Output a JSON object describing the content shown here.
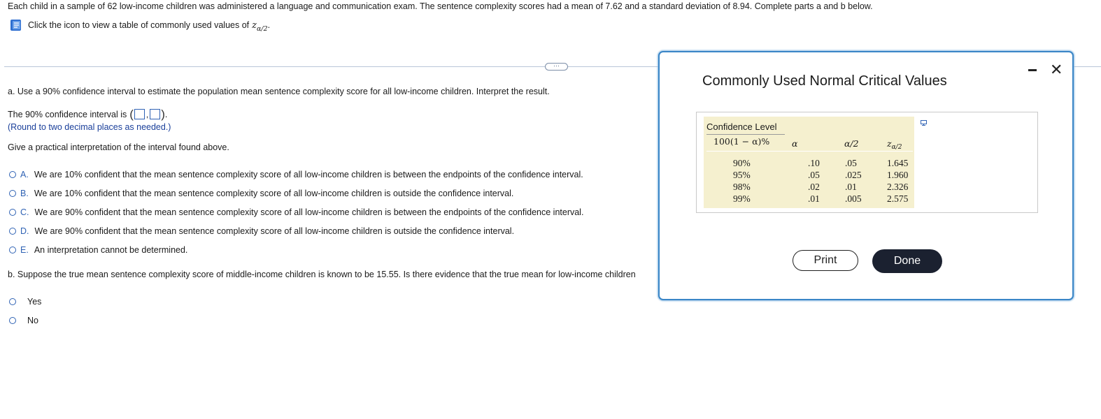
{
  "problem": {
    "intro": "Each child in a sample of 62 low-income children was administered a language and communication exam. The sentence complexity scores had a mean of 7.62 and a standard deviation of 8.94. Complete parts a and b below.",
    "help_text": "Click the icon to view a table of commonly used values of",
    "help_symbol": "z",
    "help_subscript": "α/2",
    "help_period": "."
  },
  "part_a": {
    "question": "a. Use a 90% confidence interval to estimate the population mean sentence complexity score for all low-income children. Interpret the result.",
    "ci_label": "The 90% confidence interval is",
    "ci_open": "(",
    "ci_comma": ",",
    "ci_close": ")",
    "ci_period": ".",
    "round_note": "(Round to two decimal places as needed.)",
    "interp_prompt": "Give a practical interpretation of the interval found above.",
    "options": [
      {
        "letter": "A.",
        "text": "We are 10% confident that the mean sentence complexity score of all low-income children is between the endpoints of the confidence interval."
      },
      {
        "letter": "B.",
        "text": "We are 10% confident that the mean sentence complexity score of all low-income children is outside the confidence interval."
      },
      {
        "letter": "C.",
        "text": "We are 90% confident that the mean sentence complexity score of all low-income children is between the endpoints of the confidence interval."
      },
      {
        "letter": "D.",
        "text": "We are 90% confident that the mean sentence complexity score of all low-income children is outside the confidence interval."
      },
      {
        "letter": "E.",
        "text": "An interpretation cannot be determined."
      }
    ]
  },
  "expander_label": "···",
  "part_b": {
    "question": "b. Suppose the true mean sentence complexity score of middle-income children is known to be 15.55. Is there evidence that the true mean for low-income children",
    "options": [
      "Yes",
      "No"
    ]
  },
  "dialog": {
    "title": "Commonly Used Normal Critical Values",
    "table": {
      "header_conf": "Confidence Level",
      "header_conf_formula": "100(1 − α)%",
      "header_alpha": "α",
      "header_alpha2": "α/2",
      "header_z": "z",
      "header_z_sub": "α/2",
      "confidence": [
        "90%",
        "95%",
        "98%",
        "99%"
      ],
      "alpha": [
        ".10",
        ".05",
        ".02",
        ".01"
      ],
      "alpha2": [
        ".05",
        ".025",
        ".01",
        ".005"
      ],
      "z": [
        "1.645",
        "1.960",
        "2.326",
        "2.575"
      ]
    },
    "print_label": "Print",
    "done_label": "Done",
    "close_glyph": "✕"
  },
  "colors": {
    "accent": "#2f62b4",
    "dialog_border": "#3a86c7",
    "table_bg": "#f5f0cf",
    "done_bg": "#1b2130",
    "round_note": "#1a3f9a"
  },
  "icons": [
    "help-book-icon",
    "copy-table-icon",
    "minimize-icon",
    "close-icon"
  ]
}
